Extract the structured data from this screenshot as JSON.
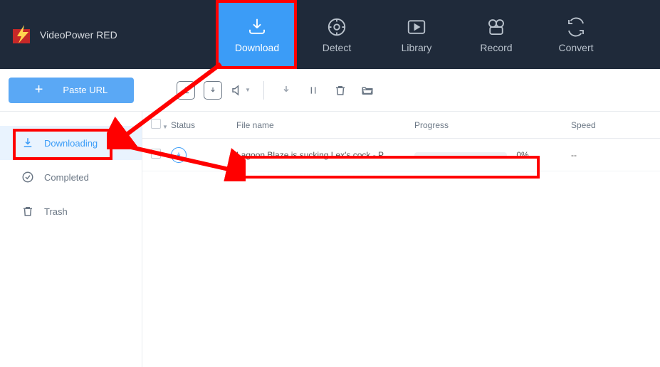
{
  "app": {
    "title": "VideoPower RED"
  },
  "nav": {
    "download": "Download",
    "detect": "Detect",
    "library": "Library",
    "record": "Record",
    "convert": "Convert"
  },
  "toolbar": {
    "paste_url": "Paste URL"
  },
  "sidebar": {
    "downloading": "Downloading",
    "completed": "Completed",
    "trash": "Trash"
  },
  "table": {
    "headers": {
      "status": "Status",
      "filename": "File name",
      "progress": "Progress",
      "speed": "Speed"
    },
    "rows": [
      {
        "filename": "Lagoon Blaze is sucking Lex's cock - P...",
        "progress_pct": "0%",
        "speed": "--"
      }
    ]
  }
}
